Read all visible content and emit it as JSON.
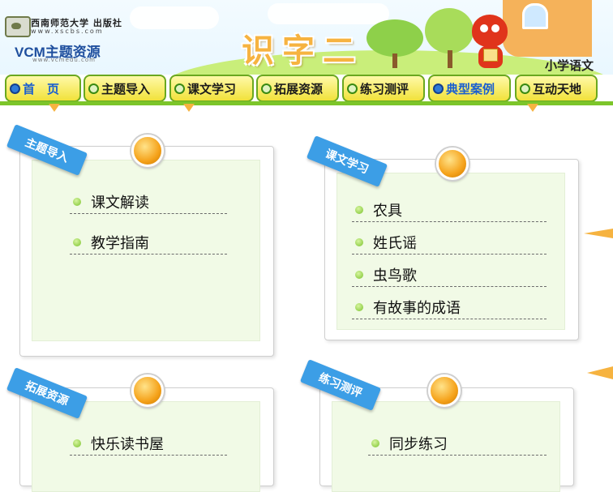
{
  "header": {
    "publisher_name": "西南师范大学 出版社",
    "publisher_url": "www.xscbs.com",
    "brand_prefix": "VCM",
    "brand_suffix": "主题资源",
    "brand_url": "www.vcmedu.com",
    "page_title": "识字二",
    "subject": "小学语文"
  },
  "nav": {
    "items": [
      {
        "label": "首　页",
        "icon": "circle-bullet-icon",
        "active": true
      },
      {
        "label": "主题导入",
        "icon": "circle-bullet-icon",
        "active": false
      },
      {
        "label": "课文学习",
        "icon": "circle-bullet-icon",
        "active": false
      },
      {
        "label": "拓展资源",
        "icon": "circle-bullet-icon",
        "active": false
      },
      {
        "label": "练习测评",
        "icon": "circle-bullet-icon",
        "active": false
      },
      {
        "label": "典型案例",
        "icon": "circle-bullet-icon",
        "active": true
      },
      {
        "label": "互动天地",
        "icon": "circle-bullet-icon",
        "active": false
      }
    ]
  },
  "panels": {
    "intro": {
      "tag": "主题导入",
      "links": [
        "课文解读",
        "教学指南"
      ]
    },
    "lessons": {
      "tag": "课文学习",
      "links": [
        "农具",
        "姓氏谣",
        "虫鸟歌",
        "有故事的成语"
      ]
    },
    "extension": {
      "tag": "拓展资源",
      "links": [
        "快乐读书屋"
      ]
    },
    "practice": {
      "tag": "练习测评",
      "links": [
        "同步练习"
      ]
    }
  },
  "colors": {
    "nav_border": "#6aa81f",
    "nav_fill": "#f1e23a",
    "tag_blue": "#3c9ee6",
    "title_orange": "#f6b340",
    "panel_inner": "#f1fae6"
  }
}
